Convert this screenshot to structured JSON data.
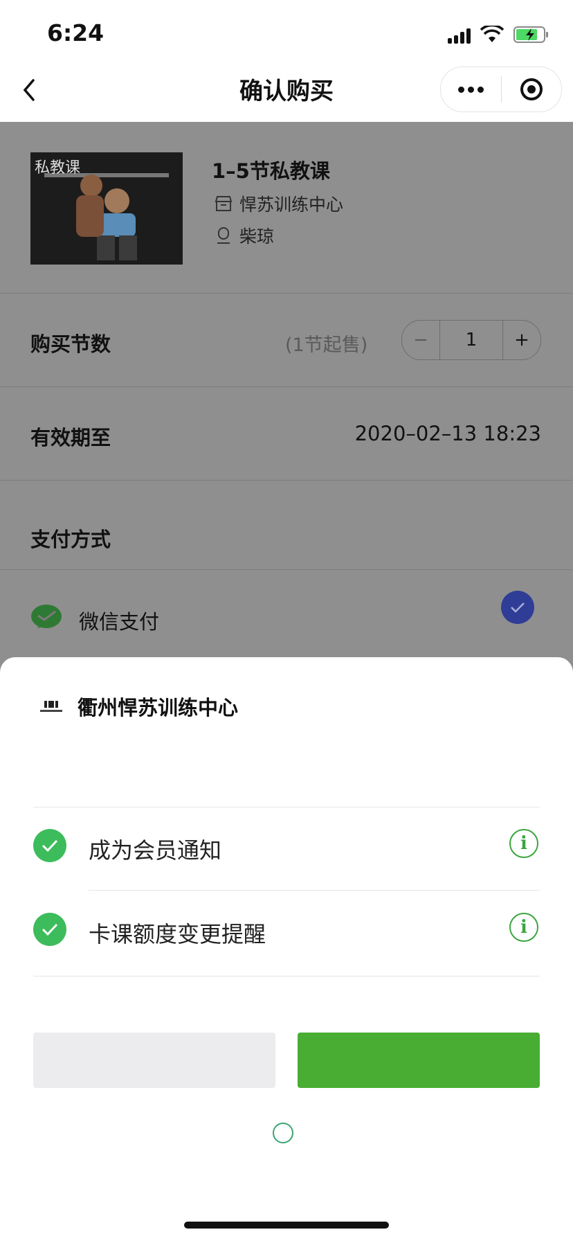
{
  "status_bar": {
    "time": "6:24"
  },
  "nav": {
    "title": "确认购买"
  },
  "product": {
    "thumb_tag": "私教课",
    "name": "1–5节私教课",
    "store": "悍苏训练中心",
    "coach": "柴琼"
  },
  "purchase_count": {
    "label": "购买节数",
    "hint": "(1节起售)",
    "minus": "−",
    "quantity": "1",
    "plus": "+"
  },
  "validity": {
    "label": "有效期至",
    "value": "2020–02–13 18:23"
  },
  "payment": {
    "label": "支付方式",
    "method": "微信支付",
    "selected": true
  },
  "sheet": {
    "brand_name": "衢州悍苏训练中心",
    "notices": [
      {
        "text": "成为会员通知",
        "checked": true
      },
      {
        "text": "卡课额度变更提醒",
        "checked": true
      }
    ],
    "cancel_label": "",
    "allow_label": ""
  },
  "colors": {
    "accent_green": "#48ad32",
    "check_green": "#3dbc5c",
    "selected_blue": "#2f3d97"
  }
}
